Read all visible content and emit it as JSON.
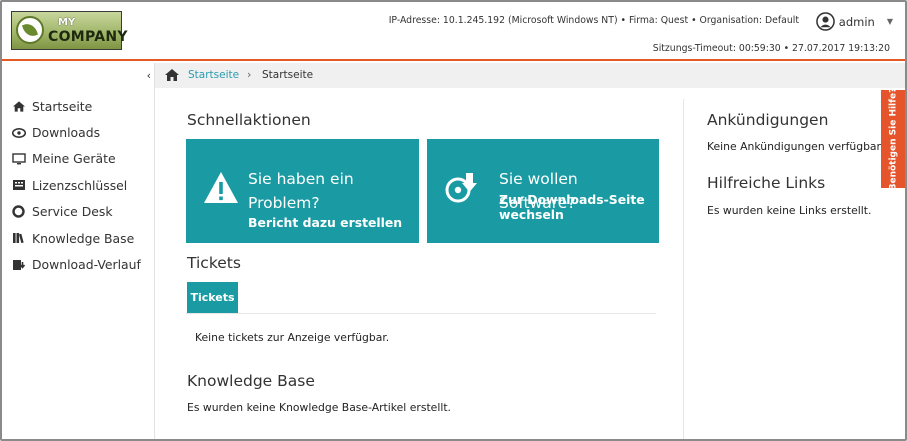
{
  "header": {
    "logo": {
      "line1": "MY",
      "line2": "COMPANY"
    },
    "info": "IP-Adresse: 10.1.245.192 (Microsoft Windows NT) • Firma: Quest • Organisation: Default",
    "user": "admin",
    "timeout": "Sitzungs-Timeout: 00:59:30 • 27.07.2017 19:13:20"
  },
  "breadcrumb": {
    "link": "Startseite",
    "separator": "›",
    "current": "Startseite"
  },
  "sidebar": {
    "collapse": "‹",
    "items": [
      {
        "label": "Startseite",
        "icon": "home-icon"
      },
      {
        "label": "Downloads",
        "icon": "disc-icon"
      },
      {
        "label": "Meine Geräte",
        "icon": "monitor-icon"
      },
      {
        "label": "Lizenzschlüssel",
        "icon": "keyboard-icon"
      },
      {
        "label": "Service Desk",
        "icon": "lifebuoy-icon"
      },
      {
        "label": "Knowledge Base",
        "icon": "books-icon"
      },
      {
        "label": "Download-Verlauf",
        "icon": "download-history-icon"
      }
    ]
  },
  "main": {
    "quick_actions_heading": "Schnellaktionen",
    "tile_problem": {
      "title_line1": "Sie haben ein",
      "title_line2": "Problem?",
      "subtitle": "Bericht dazu erstellen"
    },
    "tile_software": {
      "title": "Sie wollen Software?",
      "subtitle_line1": "Zur Downloads-Seite",
      "subtitle_line2": "wechseln"
    },
    "tickets_heading": "Tickets",
    "tickets_tab": "Tickets",
    "tickets_empty": "Keine tickets zur Anzeige verfügbar.",
    "kb_heading": "Knowledge Base",
    "kb_empty": "Es wurden keine Knowledge Base-Artikel erstellt."
  },
  "right": {
    "announcements_heading": "Ankündigungen",
    "announcements_empty": "Keine Ankündigungen verfügbar.",
    "links_heading": "Hilfreiche Links",
    "links_empty": "Es wurden keine Links erstellt."
  },
  "help_tab": "Benötigen Sie Hilfe?",
  "colors": {
    "accent_teal": "#1a9ba3",
    "header_rule": "#e35a24",
    "help_tab": "#e5542a",
    "link": "#2a9bb0"
  }
}
